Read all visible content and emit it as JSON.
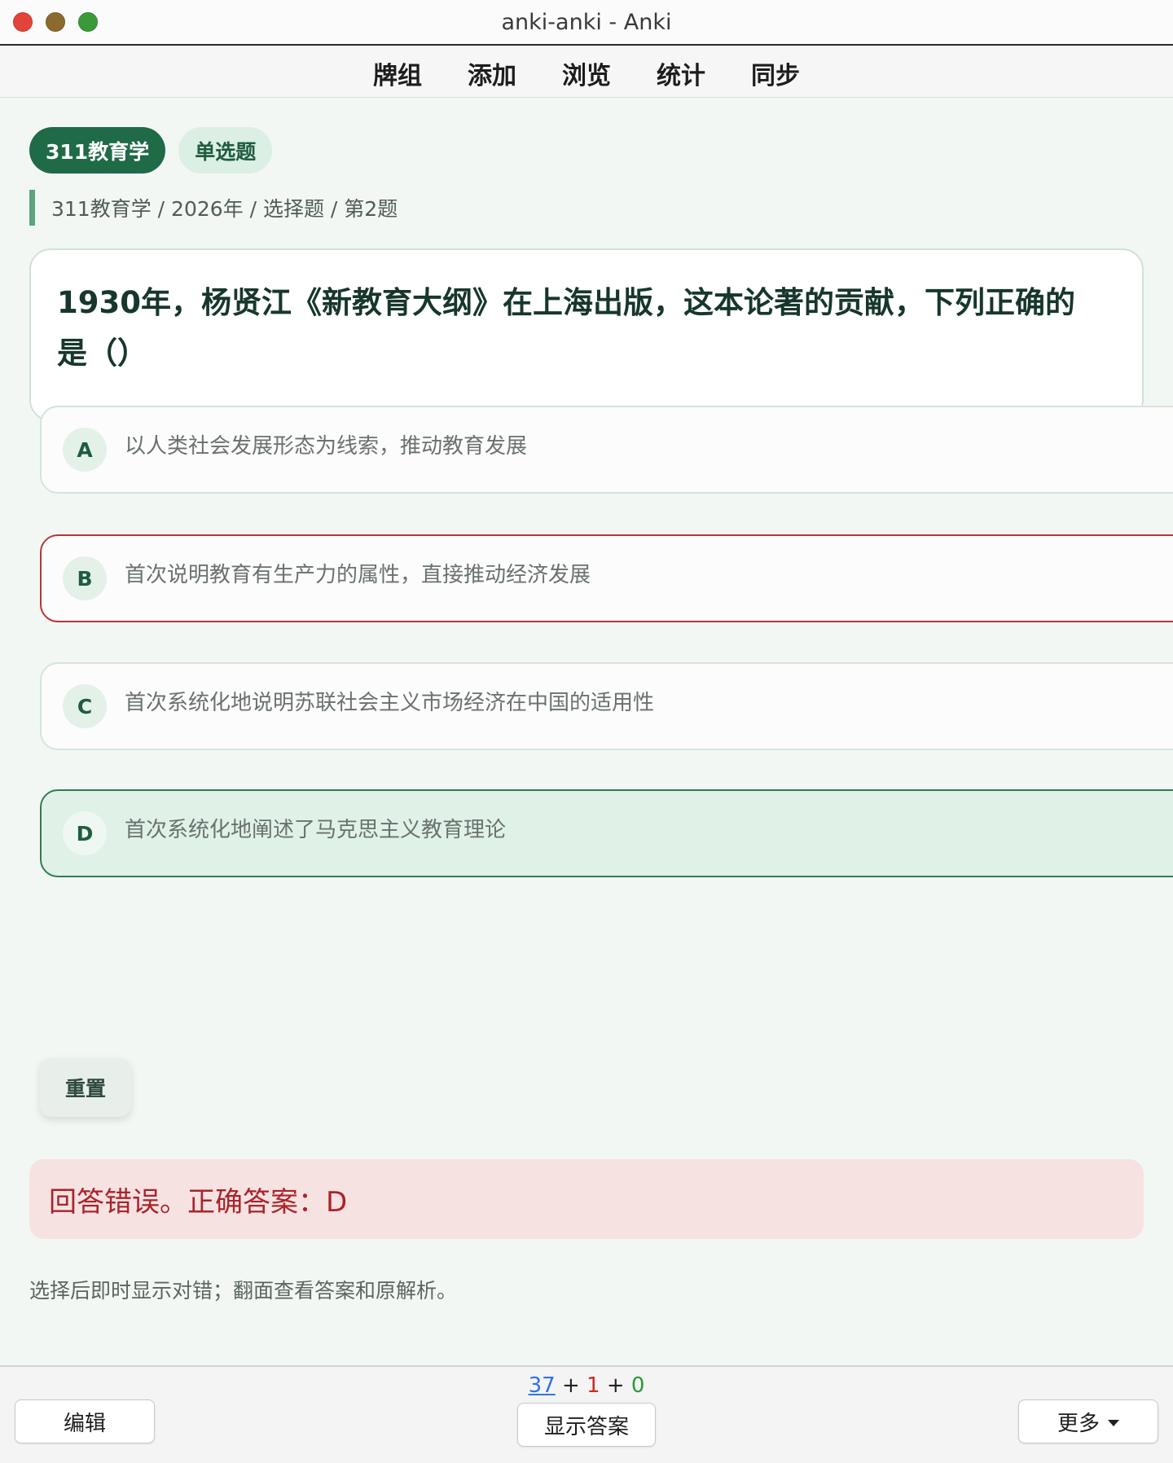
{
  "window": {
    "title": "anki-anki - Anki"
  },
  "toolbar": {
    "items": [
      "牌组",
      "添加",
      "浏览",
      "统计",
      "同步"
    ]
  },
  "card": {
    "tags": [
      "311教育学",
      "单选题"
    ],
    "breadcrumb": "311教育学 / 2026年 / 选择题 / 第2题",
    "question_line1": "1930年，杨贤江《新教育大纲》在上海出版，这本论著的贡献，下列正确的",
    "question_line2": "是（）",
    "options": [
      {
        "letter": "A",
        "text": "以人类社会发展形态为线索，推动教育发展",
        "state": "normal"
      },
      {
        "letter": "B",
        "text": "首次说明教育有生产力的属性，直接推动经济发展",
        "state": "wrong"
      },
      {
        "letter": "C",
        "text": "首次系统化地说明苏联社会主义市场经济在中国的适用性",
        "state": "normal"
      },
      {
        "letter": "D",
        "text": "首次系统化地阐述了马克思主义教育理论",
        "state": "correct"
      }
    ],
    "reset_label": "重置",
    "result_text": "回答错误。正确答案：D",
    "hint": "选择后即时显示对错；翻面查看答案和原解析。"
  },
  "bottom": {
    "edit_label": "编辑",
    "show_answer_label": "显示答案",
    "more_label": "更多",
    "counts": {
      "new": "37",
      "learn": "1",
      "review": "0",
      "sep": "+"
    }
  },
  "colors": {
    "accent_dark": "#1f6a47",
    "wrong_border": "#b8343a",
    "correct_bg": "#e0f2e7",
    "result_bg": "#f7e2e2",
    "result_text": "#a8242b",
    "count_new": "#3273e0",
    "count_learn": "#cc2b2b",
    "count_review": "#2a9a3a"
  }
}
